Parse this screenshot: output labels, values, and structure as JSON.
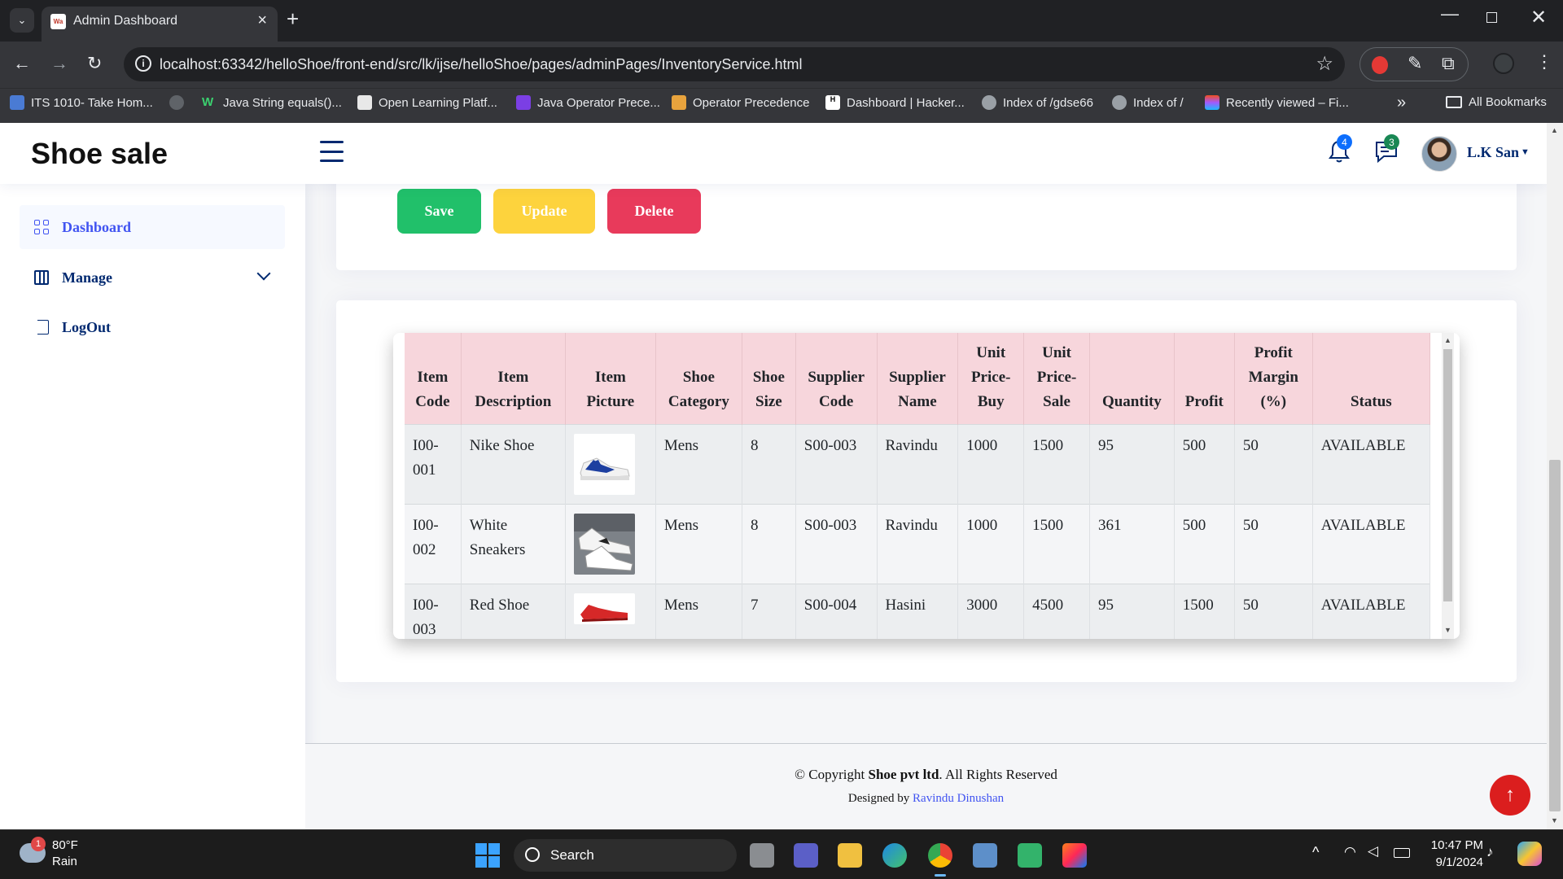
{
  "browser": {
    "tab_title": "Admin Dashboard",
    "favicon_text": "Wa",
    "url": "localhost:63342/helloShoe/front-end/src/lk/ijse/helloShoe/pages/adminPages/InventoryService.html",
    "bookmarks": [
      "ITS 1010- Take Hom...",
      "",
      "Java String equals()...",
      "Open Learning Platf...",
      "Java Operator Prece...",
      "Operator Precedence",
      "Dashboard | Hacker...",
      "Index of /gdse66",
      "Index of /",
      "Recently viewed – Fi..."
    ],
    "all_bookmarks": "All Bookmarks"
  },
  "header": {
    "brand": "Shoe sale",
    "notifications_count": "4",
    "messages_count": "3",
    "user_name": "L.K San"
  },
  "sidebar": {
    "items": [
      {
        "label": "Dashboard"
      },
      {
        "label": "Manage"
      },
      {
        "label": "LogOut"
      }
    ]
  },
  "actions": {
    "save": "Save",
    "update": "Update",
    "delete": "Delete"
  },
  "table": {
    "headers": [
      "Item Code",
      "Item Description",
      "Item Picture",
      "Shoe Category",
      "Shoe Size",
      "Supplier Code",
      "Supplier Name",
      "Unit Price-Buy",
      "Unit Price-Sale",
      "Quantity",
      "Profit",
      "Profit Margin (%)",
      "Status"
    ],
    "rows": [
      {
        "code": "I00-001",
        "description": "Nike Shoe",
        "picture": "blue-white-sneaker-image",
        "category": "Mens",
        "size": "8",
        "supplier_code": "S00-003",
        "supplier_name": "Ravindu",
        "price_buy": "1000",
        "price_sale": "1500",
        "quantity": "95",
        "profit": "500",
        "margin": "50",
        "status": "AVAILABLE"
      },
      {
        "code": "I00-002",
        "description": "White Sneakers",
        "picture": "white-sneakers-image",
        "category": "Mens",
        "size": "8",
        "supplier_code": "S00-003",
        "supplier_name": "Ravindu",
        "price_buy": "1000",
        "price_sale": "1500",
        "quantity": "361",
        "profit": "500",
        "margin": "50",
        "status": "AVAILABLE"
      },
      {
        "code": "I00-003",
        "description": "Red Shoe",
        "picture": "red-shoe-image",
        "category": "Mens",
        "size": "7",
        "supplier_code": "S00-004",
        "supplier_name": "Hasini",
        "price_buy": "3000",
        "price_sale": "4500",
        "quantity": "95",
        "profit": "1500",
        "margin": "50",
        "status": "AVAILABLE"
      }
    ]
  },
  "footer": {
    "copyright_prefix": "© Copyright",
    "company": "Shoe pvt ltd",
    "copyright_suffix": ". All Rights Reserved",
    "designed_by": "Designed by",
    "designer": "Ravindu Dinushan"
  },
  "taskbar": {
    "weather_badge": "1",
    "temperature": "80°F",
    "condition": "Rain",
    "search_label": "Search",
    "time": "10:47 PM",
    "date": "9/1/2024"
  },
  "colors": {
    "save": "#21c06a",
    "update": "#fdd33d",
    "delete": "#e83a5b",
    "table_header": "#f7d6dc",
    "back_to_top": "#db1e1e",
    "accent": "#4154f1",
    "navy": "#012970"
  }
}
